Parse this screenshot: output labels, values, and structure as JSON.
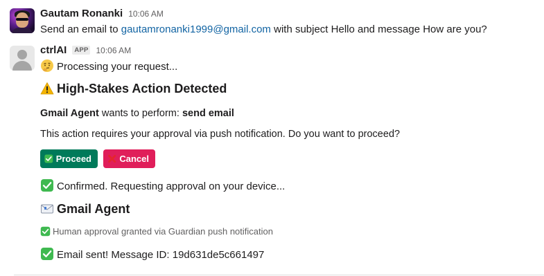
{
  "message_user": {
    "sender": "Gautam Ronanki",
    "time": "10:06 AM",
    "text_prefix": "Send an email to ",
    "email_link": "gautamronanki1999@gmail.com",
    "text_suffix": " with subject Hello and message How are you?"
  },
  "message_bot": {
    "sender": "ctrlAI",
    "badge": "APP",
    "time": "10:06 AM",
    "processing": "Processing your request...",
    "heading": "High-Stakes Action Detected",
    "agent_name": "Gmail Agent",
    "wants_to_perform": " wants to perform: ",
    "action": "send email",
    "approval_prompt": "This action requires your approval via push notification. Do you want to proceed?",
    "proceed_label": "Proceed",
    "cancel_label": "Cancel",
    "confirmed": "Confirmed. Requesting approval on your device...",
    "agent_heading": "Gmail Agent",
    "approval_granted": "Human approval granted via Guardian push notification",
    "email_sent": "Email sent! Message ID: 19d631de5c661497"
  },
  "colors": {
    "link": "#1264a3",
    "proceed": "#007a5a",
    "cancel": "#e01e5a",
    "check": "#2ea043",
    "warning": "#f4b400"
  },
  "icons": {
    "thinking": "thinking-face-icon",
    "warning": "warning-icon",
    "check": "check-mark-icon",
    "cross": "cross-mark-icon",
    "envelope": "envelope-icon"
  }
}
